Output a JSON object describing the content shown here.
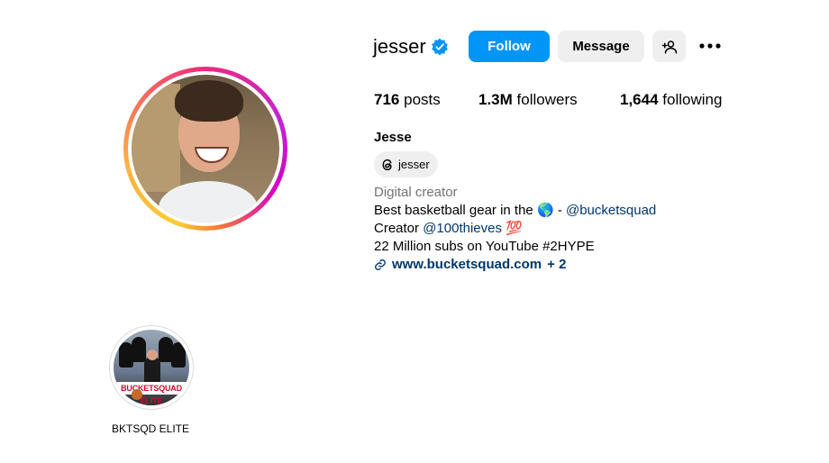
{
  "profile": {
    "username": "jesser",
    "full_name": "Jesse",
    "threads_handle": "jesser",
    "category": "Digital creator"
  },
  "actions": {
    "follow_label": "Follow",
    "message_label": "Message"
  },
  "stats": {
    "posts_count": "716",
    "posts_label": "posts",
    "followers_count": "1.3M",
    "followers_label": "followers",
    "following_count": "1,644",
    "following_label": "following"
  },
  "bio": {
    "line1_text": "Best basketball gear in the",
    "line1_emoji": "🌎",
    "line1_sep": "-",
    "line1_mention": "@bucketsquad",
    "line2_text": "Creator",
    "line2_mention": "@100thieves",
    "line2_emoji": "💯",
    "line3_text": "22 Million subs on YouTube #2HYPE",
    "link_text": "www.bucketsquad.com",
    "link_more": "+ 2"
  },
  "highlights": [
    {
      "label": "BKTSQD ELITE",
      "banner_text": "BUCKETSQUAD ELITE"
    }
  ],
  "colors": {
    "primary_button": "#0095f6",
    "secondary_button": "#efefef",
    "link": "#00376b",
    "muted_text": "#737373",
    "verified_badge": "#0095f6"
  }
}
